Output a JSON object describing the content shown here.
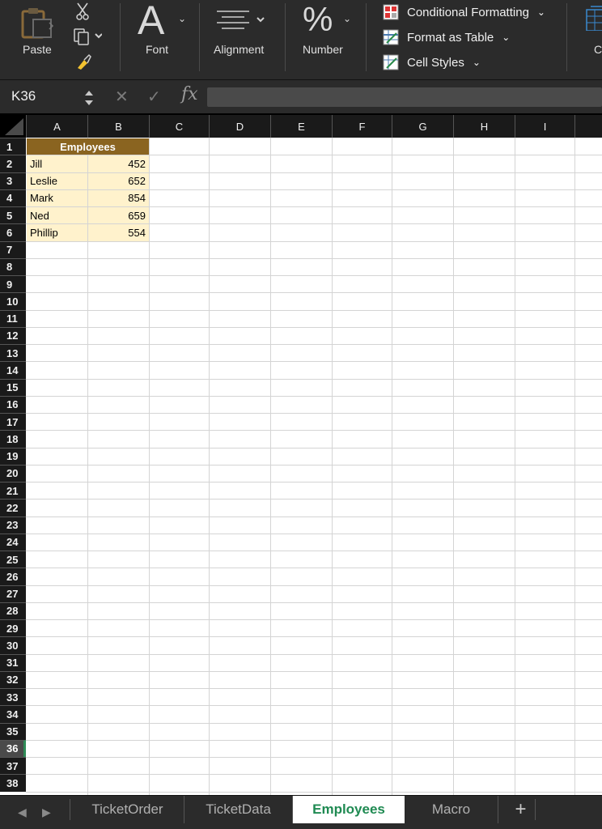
{
  "ribbon": {
    "paste_label": "Paste",
    "font_label": "Font",
    "font_glyph": "A",
    "alignment_label": "Alignment",
    "number_label": "Number",
    "number_glyph": "%",
    "cells_label": "C",
    "styles": {
      "conditional_formatting": "Conditional Formatting",
      "format_as_table": "Format as Table",
      "cell_styles": "Cell Styles"
    }
  },
  "formula_bar": {
    "name_box": "K36",
    "fx": "fx",
    "cancel_glyph": "✕",
    "enter_glyph": "✓",
    "formula": ""
  },
  "columns": [
    "A",
    "B",
    "C",
    "D",
    "E",
    "F",
    "G",
    "H",
    "I"
  ],
  "rows": [
    "1",
    "2",
    "3",
    "4",
    "5",
    "6",
    "7",
    "8",
    "9",
    "10",
    "11",
    "12",
    "13",
    "14",
    "15",
    "16",
    "17",
    "18",
    "19",
    "20",
    "21",
    "22",
    "23",
    "24",
    "25",
    "26",
    "27",
    "28",
    "29",
    "30",
    "31",
    "32",
    "33",
    "34",
    "35",
    "36",
    "37",
    "38"
  ],
  "selected_row": "36",
  "table": {
    "title": "Employees",
    "entries": [
      {
        "name": "Jill",
        "value": "452"
      },
      {
        "name": "Leslie",
        "value": "652"
      },
      {
        "name": "Mark",
        "value": "854"
      },
      {
        "name": "Ned",
        "value": "659"
      },
      {
        "name": "Phillip",
        "value": "554"
      }
    ]
  },
  "sheets": {
    "tabs": [
      "TicketOrder",
      "TicketData",
      "Employees",
      "Macro"
    ],
    "active": "Employees",
    "add_glyph": "+"
  },
  "colors": {
    "title_fill": "#8a6420",
    "data_fill": "#fff2cc",
    "active_tab_text": "#1f8a52"
  }
}
